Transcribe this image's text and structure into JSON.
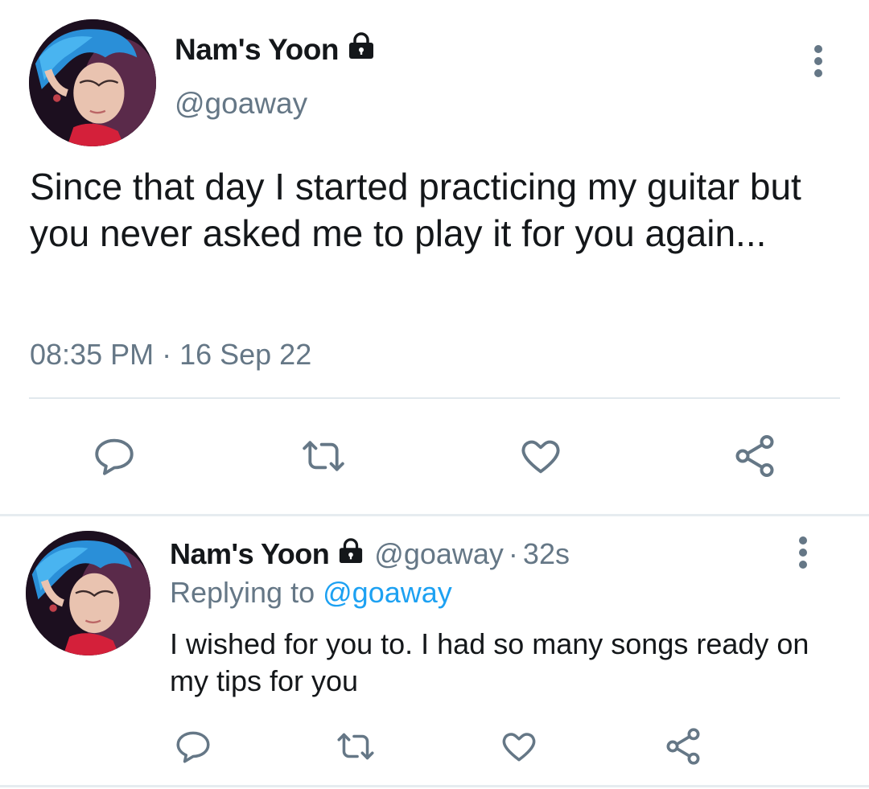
{
  "main_tweet": {
    "display_name": "Nam's Yoon",
    "handle": "@goaway",
    "text": "Since that day I started practicing my guitar but you never asked me to play it for you again...",
    "timestamp": "08:35 PM · 16 Sep 22",
    "actions": [
      "reply-icon",
      "retweet-icon",
      "like-icon",
      "share-icon"
    ]
  },
  "reply_tweet": {
    "display_name": "Nam's Yoon",
    "handle": "@goaway",
    "separator": "·",
    "age": "32s",
    "replying_prefix": "Replying to",
    "replying_to": "@goaway",
    "text": "I wished for you to. I had so many songs ready on my tips for you",
    "actions": [
      "reply-icon",
      "retweet-icon",
      "like-icon",
      "share-icon"
    ]
  },
  "colors": {
    "primary_text": "#14171a",
    "secondary_text": "#657786",
    "link": "#1da1f2",
    "divider": "#e1e8ed"
  }
}
